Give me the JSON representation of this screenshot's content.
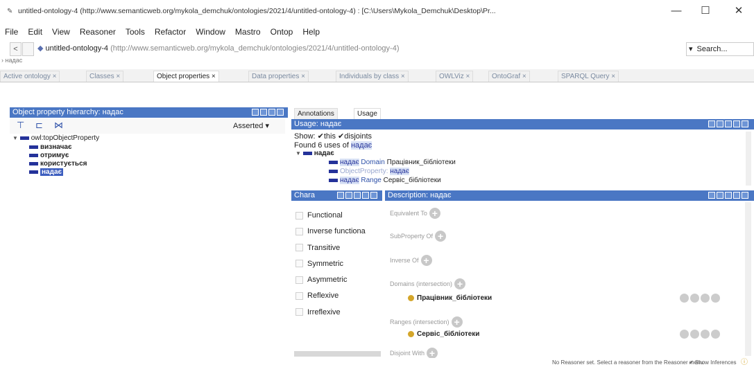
{
  "window": {
    "title": "untitled-ontology-4 (http://www.semanticweb.org/mykola_demchuk/ontologies/2021/4/untitled-ontology-4) : [C:\\Users\\Mykola_Demchuk\\Desktop\\Pr...",
    "minimize": "—",
    "maximize": "☐",
    "close": "✕"
  },
  "menu": [
    "File",
    "Edit",
    "View",
    "Reasoner",
    "Tools",
    "Refactor",
    "Window",
    "Mastro",
    "Ontop",
    "Help"
  ],
  "address": {
    "back": "<",
    "forward": "",
    "ontology_name": "untitled-ontology-4",
    "ontology_iri": "(http://www.semanticweb.org/mykola_demchuk/ontologies/2021/4/untitled-ontology-4)",
    "search_label": "Search...",
    "breadcrumb": "надас"
  },
  "tabs": [
    "Active ontology ×",
    "Classes ×",
    "Object properties ×",
    "Data properties ×",
    "Individuals by class ×",
    "OWLViz ×",
    "OntoGraf ×",
    "SPARQL Query ×"
  ],
  "hierarchy": {
    "title": "Object property hierarchy: надас",
    "mode": "Asserted ▾",
    "root": "owl:topObjectProperty",
    "children": [
      "визначає",
      "отримує",
      "користується",
      "надає"
    ]
  },
  "subtabs": [
    "Annotations",
    "Usage"
  ],
  "usage": {
    "title": "Usage: надає",
    "show_label": "Show:",
    "this_label": "this",
    "disjoints_label": "disjoints",
    "found_prefix": "Found 6 uses of",
    "subject": "надає",
    "root_node": "надає",
    "line1_prop": "надає",
    "line1_kw": "Domain",
    "line1_val": "Працівник_бібліотеки",
    "line2_kw": "ObjectProperty:",
    "line2_val": "надає",
    "line3_prop": "надає",
    "line3_kw": "Range",
    "line3_val": "Сервіс_бібліотеки"
  },
  "characteristics": {
    "title": "Chara",
    "items": [
      "Functional",
      "Inverse functiona",
      "Transitive",
      "Symmetric",
      "Asymmetric",
      "Reflexive",
      "Irreflexive"
    ]
  },
  "description": {
    "title": "Description: надає",
    "equivalent_to": "Equivalent To",
    "subproperty_of": "SubProperty Of",
    "inverse_of": "Inverse Of",
    "domains": "Domains (intersection)",
    "domain_value": "Працівник_бібліотеки",
    "ranges": "Ranges (intersection)",
    "range_value": "Сервіс_бібліотеки",
    "disjoint_with": "Disjoint With"
  },
  "status": {
    "message": "No Reasoner set. Select a reasoner from the Reasoner menu",
    "show_inferences": "Show Inferences"
  },
  "colors": {
    "header_blue": "#4a77c4",
    "selection_blue": "#3d5ebf",
    "property_bar": "#24329a",
    "class_dot": "#d4a62a"
  }
}
